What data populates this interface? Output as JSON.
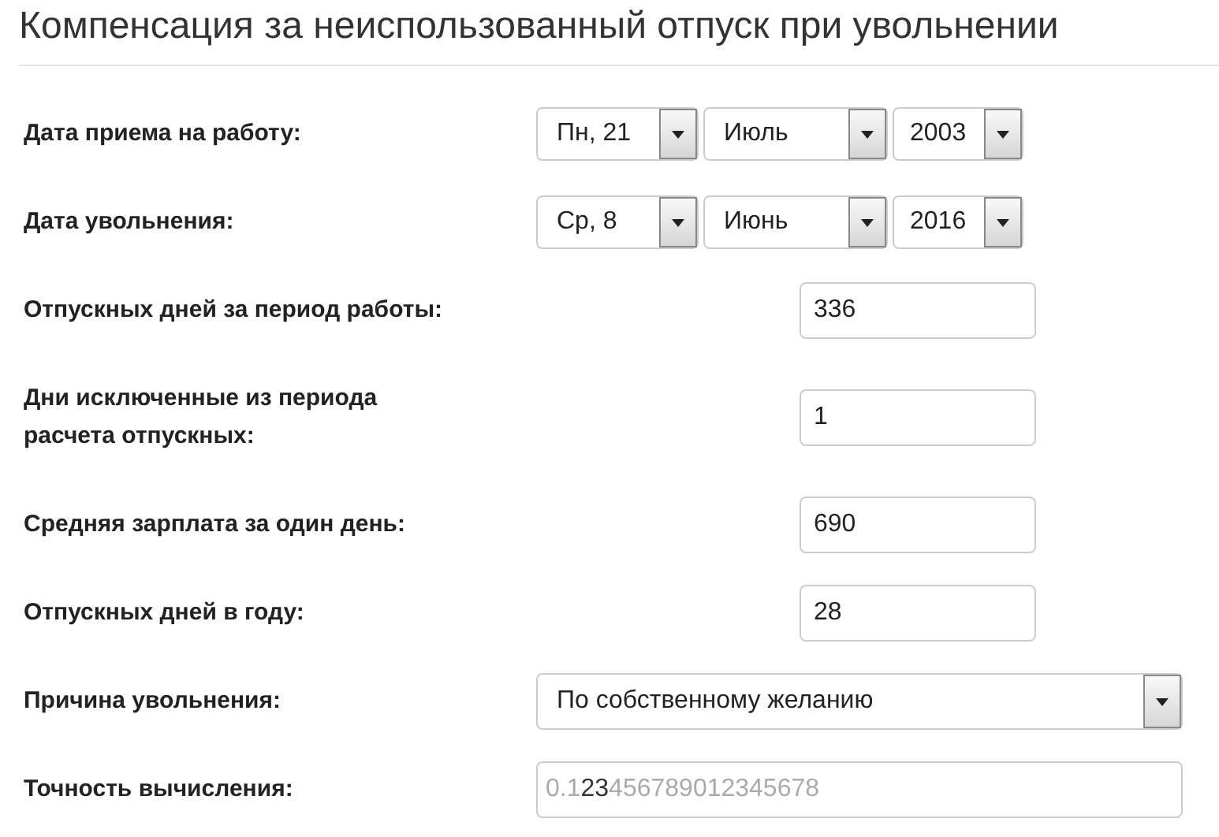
{
  "title": "Компенсация за неиспользованный отпуск при увольнении",
  "rows": [
    {
      "kind": "date",
      "label": "Дата приема на работу:",
      "parts": [
        "Пн, 21",
        "Июль",
        "2003"
      ]
    },
    {
      "kind": "date",
      "label": "Дата увольнения:",
      "parts": [
        "Ср, 8",
        "Июнь",
        "2016"
      ]
    },
    {
      "kind": "input",
      "label": "Отпускных дней за период работы:",
      "value": "336"
    },
    {
      "kind": "input",
      "label": "Дни исключенные из периода расчета отпускных:",
      "value": "1"
    },
    {
      "kind": "input",
      "label": "Средняя зарплата за один день:",
      "value": "690"
    },
    {
      "kind": "input",
      "label": "Отпускных дней в году:",
      "value": "28"
    },
    {
      "kind": "select",
      "label": "Причина увольнения:",
      "value": "По собственному желанию"
    },
    {
      "kind": "precision",
      "label": "Точность вычисления:",
      "parts": [
        {
          "text": "0.1",
          "muted": true
        },
        {
          "text": "23",
          "muted": false
        },
        {
          "text": "456789012345678",
          "muted": true
        }
      ]
    }
  ]
}
